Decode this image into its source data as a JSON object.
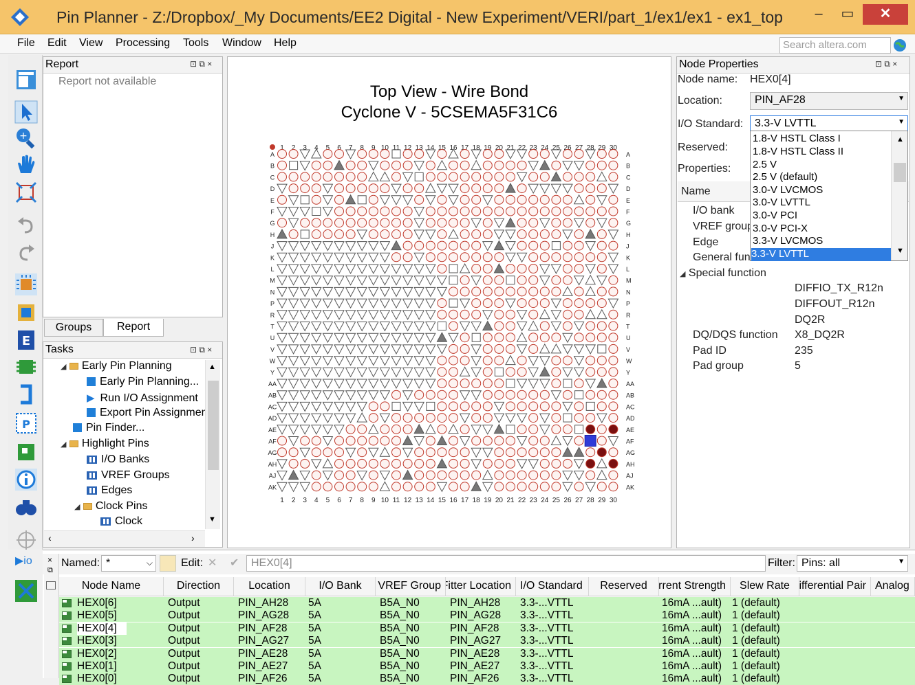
{
  "window": {
    "title": "Pin Planner - Z:/Dropbox/_My Documents/EE2 Digital - New Experiment/VERI/part_1/ex1/ex1 - ex1_top",
    "minimize": "‒",
    "maximize": "▭",
    "close": "✕"
  },
  "menu": [
    "File",
    "Edit",
    "View",
    "Processing",
    "Tools",
    "Window",
    "Help"
  ],
  "search": {
    "placeholder": "Search altera.com"
  },
  "report_panel": {
    "title": "Report",
    "message": "Report not available"
  },
  "panel_tabs": [
    "Groups",
    "Report"
  ],
  "tasks_panel": {
    "title": "Tasks",
    "items": [
      {
        "label": "Early Pin Planning",
        "level": 1,
        "icon": "folder"
      },
      {
        "label": "Early Pin Planning...",
        "level": 2,
        "icon": "blue-square"
      },
      {
        "label": "Run I/O Assignment",
        "level": 2,
        "icon": "play"
      },
      {
        "label": "Export Pin Assignments",
        "level": 2,
        "icon": "blue-square"
      },
      {
        "label": "Pin Finder...",
        "level": 1,
        "icon": "blue-square"
      },
      {
        "label": "Highlight Pins",
        "level": 1,
        "icon": "folder"
      },
      {
        "label": "I/O Banks",
        "level": 2,
        "icon": "grid"
      },
      {
        "label": "VREF Groups",
        "level": 2,
        "icon": "grid"
      },
      {
        "label": "Edges",
        "level": 2,
        "icon": "grid"
      },
      {
        "label": "Clock Pins",
        "level": 2,
        "icon": "folder"
      },
      {
        "label": "Clock",
        "level": 3,
        "icon": "grid"
      }
    ]
  },
  "chip_view": {
    "title_line1": "Top View - Wire Bond",
    "title_line2": "Cyclone V - 5CSEMA5F31C6",
    "columns": [
      "1",
      "2",
      "3",
      "4",
      "5",
      "6",
      "7",
      "8",
      "9",
      "10",
      "11",
      "12",
      "13",
      "14",
      "15",
      "16",
      "17",
      "18",
      "19",
      "20",
      "21",
      "22",
      "23",
      "24",
      "25",
      "26",
      "27",
      "28",
      "29",
      "30"
    ],
    "rows": [
      "A",
      "B",
      "C",
      "D",
      "E",
      "F",
      "G",
      "H",
      "J",
      "K",
      "L",
      "M",
      "N",
      "P",
      "R",
      "T",
      "U",
      "V",
      "W",
      "Y",
      "AA",
      "AB",
      "AC",
      "AD",
      "AE",
      "AF",
      "AG",
      "AH",
      "AJ",
      "AK"
    ]
  },
  "node_properties": {
    "title": "Node Properties",
    "node_name_label": "Node name:",
    "node_name": "HEX0[4]",
    "location_label": "Location:",
    "location": "PIN_AF28",
    "io_standard_label": "I/O Standard:",
    "io_standard": "3.3-V LVTTL",
    "reserved_label": "Reserved:",
    "properties_label": "Properties:",
    "io_standard_options": [
      "1.8-V HSTL Class I",
      "1.8-V HSTL Class II",
      "2.5 V",
      "2.5 V (default)",
      "3.0-V LVCMOS",
      "3.0-V LVTTL",
      "3.0-V PCI",
      "3.0-V PCI-X",
      "3.3-V LVCMOS",
      "3.3-V LVTTL"
    ],
    "table_header": "Name",
    "props": [
      {
        "name": "I/O bank",
        "value": ""
      },
      {
        "name": "VREF group",
        "value": ""
      },
      {
        "name": "Edge",
        "value": ""
      },
      {
        "name": "General function",
        "value": ""
      },
      {
        "name": "Special function",
        "value": ""
      }
    ],
    "special_function_values": [
      "DIFFIO_TX_R12n",
      "DIFFOUT_R12n",
      "DQ2R"
    ],
    "dq_label": "DQ/DQS function",
    "dq_value": "X8_DQ2R",
    "pad_id_label": "Pad ID",
    "pad_id": "235",
    "pad_group_label": "Pad group",
    "pad_group": "5"
  },
  "bottom": {
    "named_label": "Named:",
    "named_value": "*",
    "edit_label": "Edit:",
    "edit_value": "HEX0[4]",
    "filter_label": "Filter:",
    "filter_value": "Pins: all",
    "columns": [
      "Node Name",
      "Direction",
      "Location",
      "I/O Bank",
      "VREF Group",
      "Fitter Location",
      "I/O Standard",
      "Reserved",
      "Current Strength",
      "Slew Rate",
      "Differential Pair",
      "Analog"
    ],
    "rows": [
      {
        "name": "HEX0[6]",
        "dir": "Output",
        "loc": "PIN_AH28",
        "bank": "5A",
        "vref": "B5A_N0",
        "fit": "PIN_AH28",
        "std": "3.3-...VTTL",
        "res": "",
        "cur": "16mA ...ault)",
        "slew": "1 (default)"
      },
      {
        "name": "HEX0[5]",
        "dir": "Output",
        "loc": "PIN_AG28",
        "bank": "5A",
        "vref": "B5A_N0",
        "fit": "PIN_AG28",
        "std": "3.3-...VTTL",
        "res": "",
        "cur": "16mA ...ault)",
        "slew": "1 (default)"
      },
      {
        "name": "HEX0[4]",
        "dir": "Output",
        "loc": "PIN_AF28",
        "bank": "5A",
        "vref": "B5A_N0",
        "fit": "PIN_AF28",
        "std": "3.3-...VTTL",
        "res": "",
        "cur": "16mA ...ault)",
        "slew": "1 (default)"
      },
      {
        "name": "HEX0[3]",
        "dir": "Output",
        "loc": "PIN_AG27",
        "bank": "5A",
        "vref": "B5A_N0",
        "fit": "PIN_AG27",
        "std": "3.3-...VTTL",
        "res": "",
        "cur": "16mA ...ault)",
        "slew": "1 (default)"
      },
      {
        "name": "HEX0[2]",
        "dir": "Output",
        "loc": "PIN_AE28",
        "bank": "5A",
        "vref": "B5A_N0",
        "fit": "PIN_AE28",
        "std": "3.3-...VTTL",
        "res": "",
        "cur": "16mA ...ault)",
        "slew": "1 (default)"
      },
      {
        "name": "HEX0[1]",
        "dir": "Output",
        "loc": "PIN_AE27",
        "bank": "5A",
        "vref": "B5A_N0",
        "fit": "PIN_AE27",
        "std": "3.3-...VTTL",
        "res": "",
        "cur": "16mA ...ault)",
        "slew": "1 (default)"
      },
      {
        "name": "HEX0[0]",
        "dir": "Output",
        "loc": "PIN_AF26",
        "bank": "5A",
        "vref": "B5A_N0",
        "fit": "PIN_AF26",
        "std": "3.3-...VTTL",
        "res": "",
        "cur": "16mA ...ault)",
        "slew": "1 (default)"
      }
    ]
  },
  "colors": {
    "titlebar": "#f5c46a",
    "close": "#c9413a",
    "selection": "#2f7de1",
    "row_bg": "#c8f5c0",
    "pin_red": "#c0392b"
  }
}
